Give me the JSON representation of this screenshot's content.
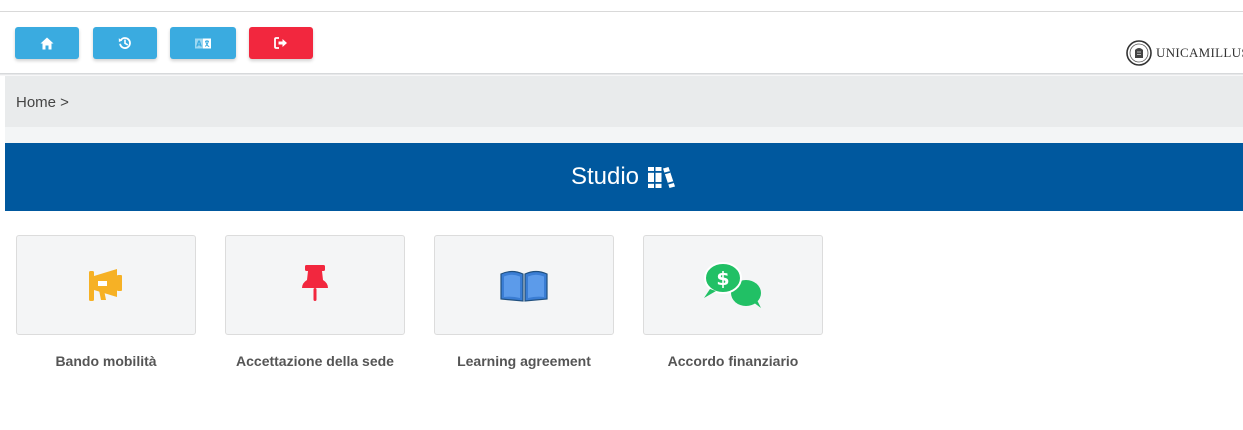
{
  "toolbar": {
    "buttons": [
      {
        "name": "home",
        "icon": "home-icon",
        "color": "#3aabe0"
      },
      {
        "name": "history",
        "icon": "history-icon",
        "color": "#3aabe0"
      },
      {
        "name": "translate",
        "icon": "translate-icon",
        "color": "#3aabe0"
      },
      {
        "name": "logout",
        "icon": "logout-icon",
        "color": "#f2273e"
      }
    ],
    "logo": {
      "text": "UNICAMILLUS",
      "icon": "university-seal-icon"
    }
  },
  "breadcrumb": {
    "text": "Home >"
  },
  "section": {
    "title": "Studio",
    "icon": "books-icon",
    "background": "#00589e"
  },
  "cards": [
    {
      "label": "Bando mobilità",
      "icon": "megaphone-icon",
      "color": "#f6b125"
    },
    {
      "label": "Accettazione della sede",
      "icon": "thumbtack-icon",
      "color": "#f2273e"
    },
    {
      "label": "Learning agreement",
      "icon": "open-book-icon",
      "color": "#3a7dd4"
    },
    {
      "label": "Accordo finanziario",
      "icon": "money-chat-icon",
      "color": "#21c065"
    }
  ]
}
